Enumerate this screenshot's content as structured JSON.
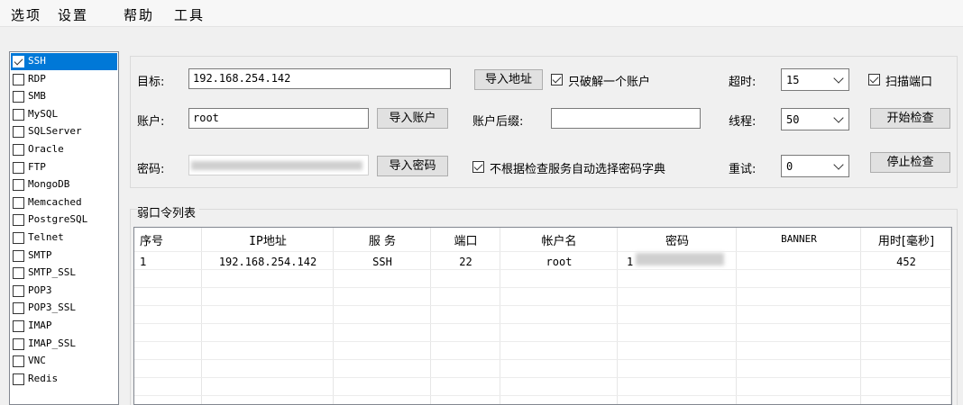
{
  "menu": [
    "选项",
    "设置",
    "帮助",
    "工具"
  ],
  "services": [
    {
      "label": "SSH",
      "checked": true,
      "selected": true
    },
    {
      "label": "RDP",
      "checked": false
    },
    {
      "label": "SMB",
      "checked": false
    },
    {
      "label": "MySQL",
      "checked": false
    },
    {
      "label": "SQLServer",
      "checked": false
    },
    {
      "label": "Oracle",
      "checked": false
    },
    {
      "label": "FTP",
      "checked": false
    },
    {
      "label": "MongoDB",
      "checked": false
    },
    {
      "label": "Memcached",
      "checked": false
    },
    {
      "label": "PostgreSQL",
      "checked": false
    },
    {
      "label": "Telnet",
      "checked": false
    },
    {
      "label": "SMTP",
      "checked": false
    },
    {
      "label": "SMTP_SSL",
      "checked": false
    },
    {
      "label": "POP3",
      "checked": false
    },
    {
      "label": "POP3_SSL",
      "checked": false
    },
    {
      "label": "IMAP",
      "checked": false
    },
    {
      "label": "IMAP_SSL",
      "checked": false
    },
    {
      "label": "VNC",
      "checked": false
    },
    {
      "label": "Redis",
      "checked": false
    }
  ],
  "settings": {
    "target_label": "目标:",
    "target_value": "192.168.254.142",
    "import_address": "导入地址",
    "only_one_account": "只破解一个账户",
    "timeout_label": "超时:",
    "timeout_value": "15",
    "scan_port": "扫描端口",
    "account_label": "账户:",
    "account_value": "root",
    "import_account": "导入账户",
    "account_suffix_label": "账户后缀:",
    "account_suffix_value": "",
    "threads_label": "线程:",
    "threads_value": "50",
    "start_check": "开始检查",
    "password_label": "密码:",
    "import_password": "导入密码",
    "auto_dict": "不根据检查服务自动选择密码字典",
    "retry_label": "重试:",
    "retry_value": "0",
    "stop_check": "停止检查"
  },
  "table": {
    "title": "弱口令列表",
    "headers": [
      "序号",
      "IP地址",
      "服 务",
      "端口",
      "帐户名",
      "密码",
      "BANNER",
      "用时[毫秒]"
    ],
    "rows": [
      {
        "no": "1",
        "ip": "192.168.254.142",
        "service": "SSH",
        "port": "22",
        "user": "root",
        "password": "1",
        "banner": "",
        "time": "452"
      }
    ]
  }
}
